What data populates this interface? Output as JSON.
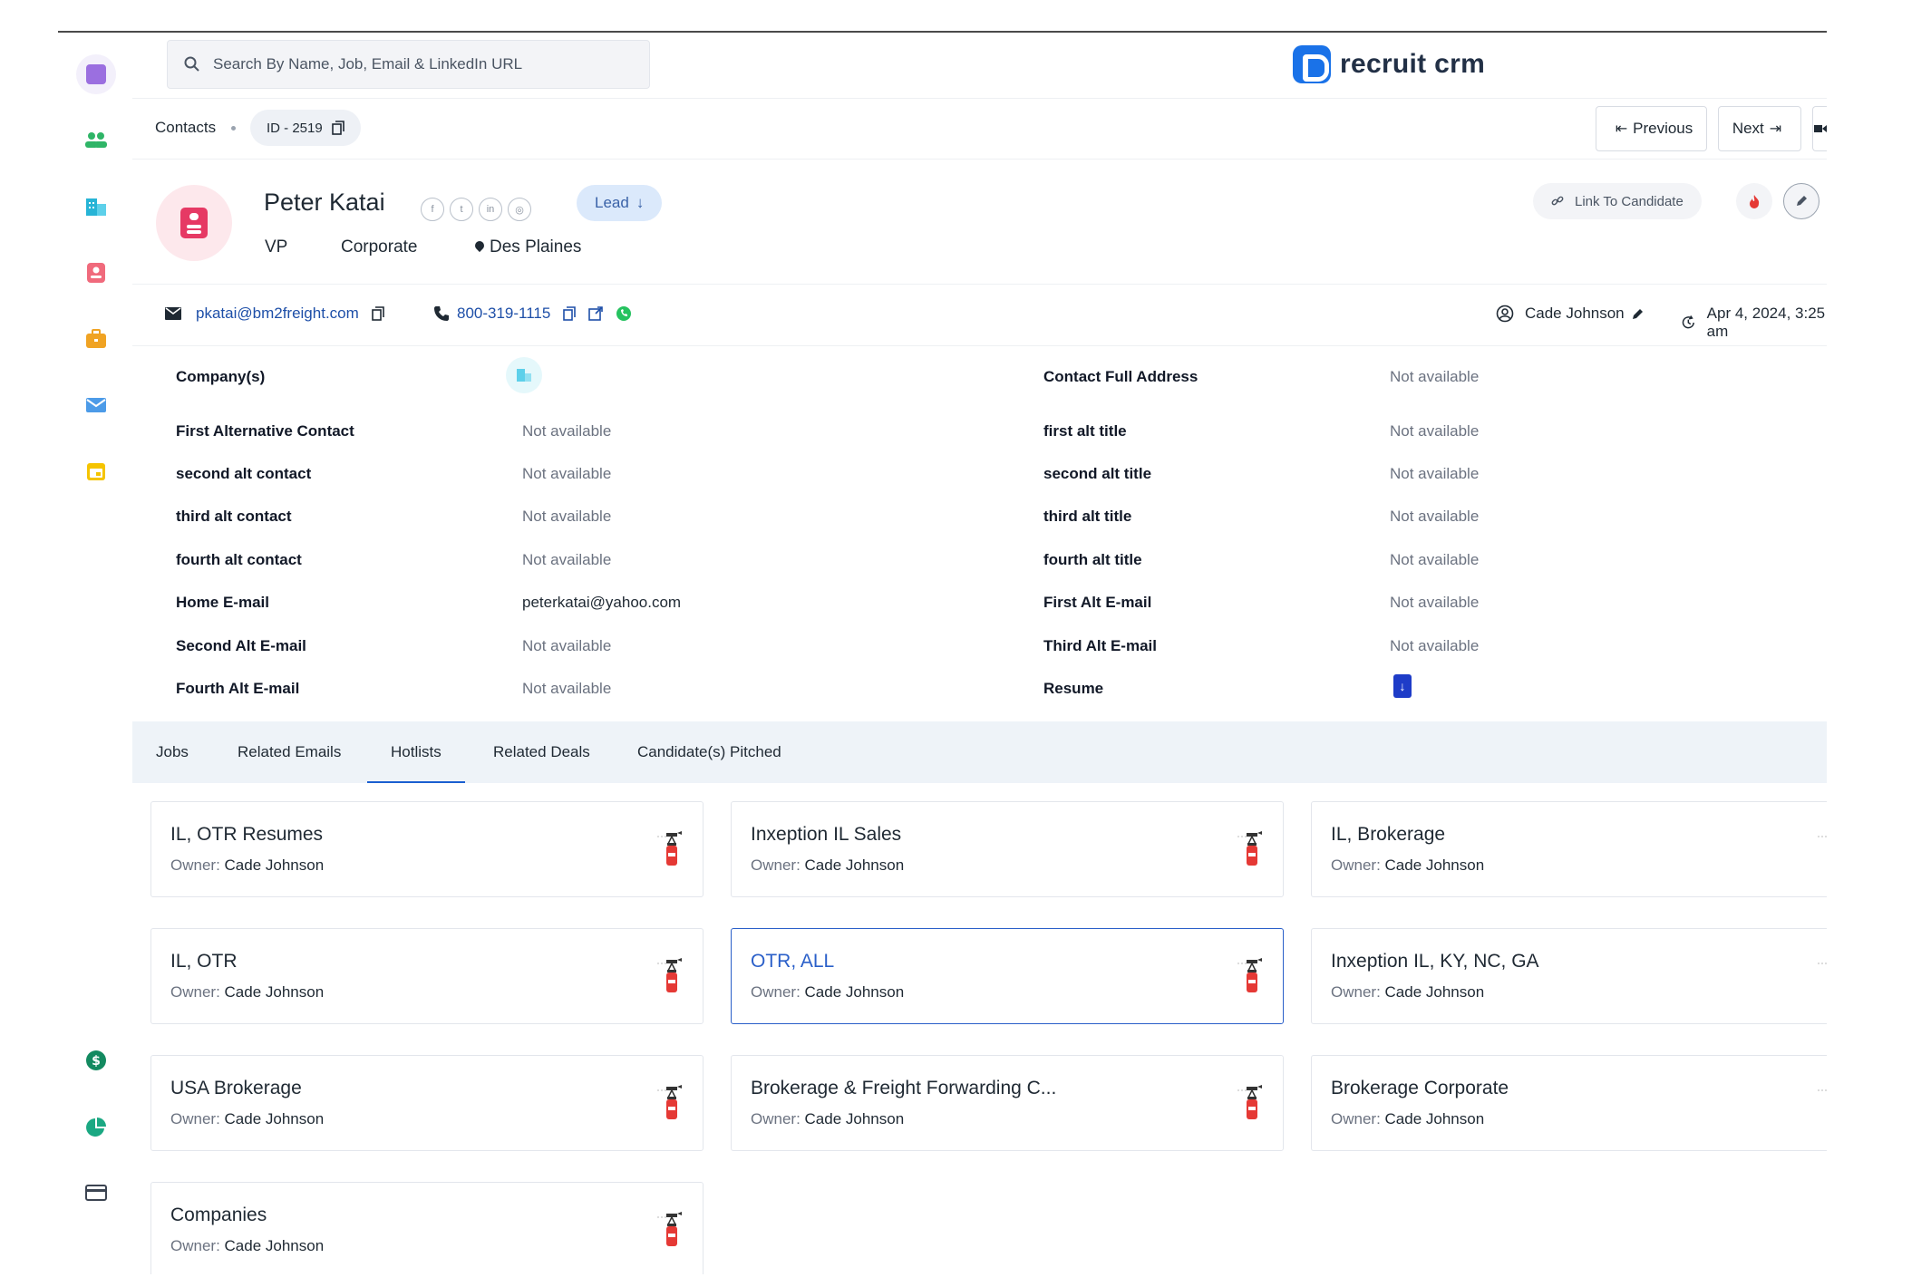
{
  "search": {
    "placeholder": "Search By Name, Job, Email & LinkedIn URL"
  },
  "brand": {
    "name": "recruit crm"
  },
  "breadcrumb": {
    "section": "Contacts",
    "id": "ID - 2519"
  },
  "nav": {
    "previous": "Previous",
    "next": "Next"
  },
  "contact": {
    "name": "Peter Katai",
    "status": "Lead",
    "title": "VP",
    "type": "Corporate",
    "location": "Des Plaines",
    "email": "pkatai@bm2freight.com",
    "phone": "800-319-1115",
    "owner": "Cade Johnson",
    "updated": "Apr 4, 2024, 3:25 am"
  },
  "actions": {
    "link_candidate": "Link To Candidate"
  },
  "fields_left": [
    {
      "label": "Company(s)",
      "value": ""
    },
    {
      "label": "First Alternative Contact",
      "value": "Not available"
    },
    {
      "label": "second alt contact",
      "value": "Not available"
    },
    {
      "label": "third alt contact",
      "value": "Not available"
    },
    {
      "label": "fourth alt contact",
      "value": "Not available"
    },
    {
      "label": "Home E-mail",
      "value": "peterkatai@yahoo.com"
    },
    {
      "label": "Second Alt E-mail",
      "value": "Not available"
    },
    {
      "label": "Fourth Alt E-mail",
      "value": "Not available"
    }
  ],
  "fields_right": [
    {
      "label": "Contact Full Address",
      "value": "Not available"
    },
    {
      "label": "first alt title",
      "value": "Not available"
    },
    {
      "label": "second alt title",
      "value": "Not available"
    },
    {
      "label": "third alt title",
      "value": "Not available"
    },
    {
      "label": "fourth alt title",
      "value": "Not available"
    },
    {
      "label": "First Alt E-mail",
      "value": "Not available"
    },
    {
      "label": "Third Alt E-mail",
      "value": "Not available"
    },
    {
      "label": "Resume",
      "value": ""
    }
  ],
  "tabs": [
    {
      "label": "Jobs"
    },
    {
      "label": "Related Emails"
    },
    {
      "label": "Hotlists",
      "active": true
    },
    {
      "label": "Related Deals"
    },
    {
      "label": "Candidate(s) Pitched"
    }
  ],
  "hotlists": {
    "owner_label": "Owner:",
    "items": [
      {
        "title": "IL, OTR Resumes",
        "owner": "Cade Johnson"
      },
      {
        "title": "Inxeption IL Sales",
        "owner": "Cade Johnson"
      },
      {
        "title": "IL, Brokerage",
        "owner": "Cade Johnson"
      },
      {
        "title": "IL, OTR",
        "owner": "Cade Johnson"
      },
      {
        "title": "OTR, ALL",
        "owner": "Cade Johnson",
        "selected": true
      },
      {
        "title": "Inxeption IL, KY, NC, GA",
        "owner": "Cade Johnson"
      },
      {
        "title": "USA Brokerage",
        "owner": "Cade Johnson"
      },
      {
        "title": "Brokerage & Freight Forwarding C...",
        "owner": "Cade Johnson"
      },
      {
        "title": "Brokerage Corporate",
        "owner": "Cade Johnson"
      },
      {
        "title": "Companies",
        "owner": "Cade Johnson"
      }
    ]
  },
  "colors": {
    "accent": "#1a5fd1",
    "lead_chip": "#dbe9fb",
    "avatar_bg": "#fde8ec",
    "avatar_icon": "#e63964"
  }
}
